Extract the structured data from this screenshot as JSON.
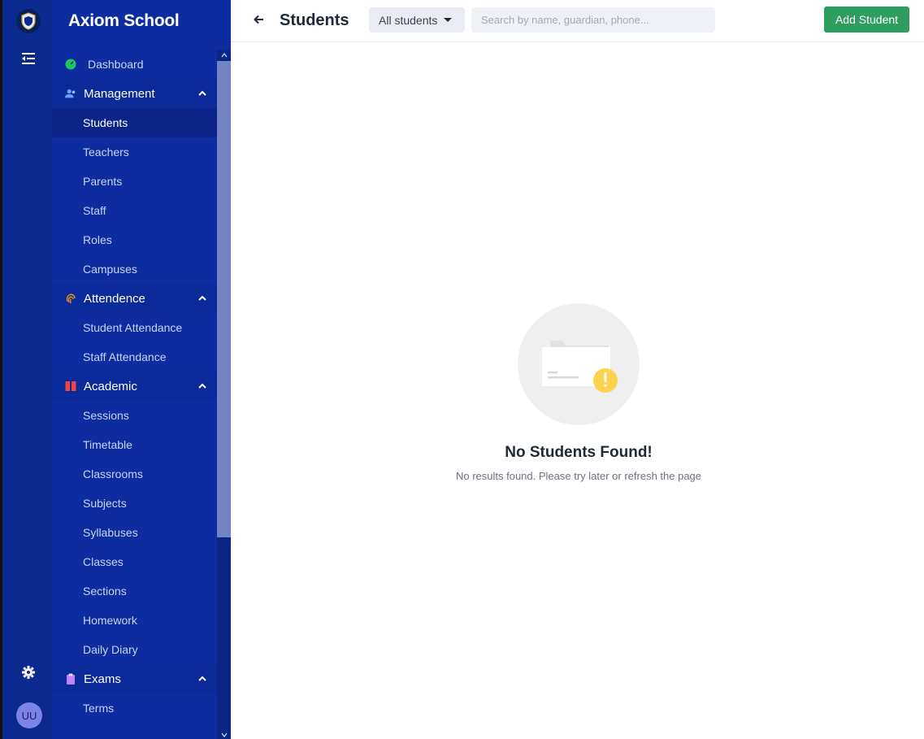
{
  "app": {
    "name": "Axiom School"
  },
  "rail": {
    "avatar_initials": "UU"
  },
  "sidebar": {
    "dashboard": "Dashboard",
    "groups": [
      {
        "label": "Management",
        "icon": "users-icon",
        "items": [
          "Students",
          "Teachers",
          "Parents",
          "Staff",
          "Roles",
          "Campuses"
        ]
      },
      {
        "label": "Attendence",
        "icon": "fingerprint-icon",
        "items": [
          "Student Attendance",
          "Staff Attendance"
        ]
      },
      {
        "label": "Academic",
        "icon": "book-icon",
        "items": [
          "Sessions",
          "Timetable",
          "Classrooms",
          "Subjects",
          "Syllabuses",
          "Classes",
          "Sections",
          "Homework",
          "Daily Diary"
        ]
      },
      {
        "label": "Exams",
        "icon": "clipboard-icon",
        "items": [
          "Terms"
        ]
      }
    ],
    "active_item": "Students"
  },
  "header": {
    "title": "Students",
    "filter_value": "All students",
    "search_placeholder": "Search by name, guardian, phone...",
    "add_button": "Add Student"
  },
  "empty_state": {
    "title": "No Students Found!",
    "subtitle": "No results found. Please try later or refresh the page"
  },
  "colors": {
    "sidebar": "#0c2ca0",
    "rail": "#0b2a8f",
    "accent_green": "#2f9d5d",
    "warning_yellow": "#fcd34d"
  }
}
